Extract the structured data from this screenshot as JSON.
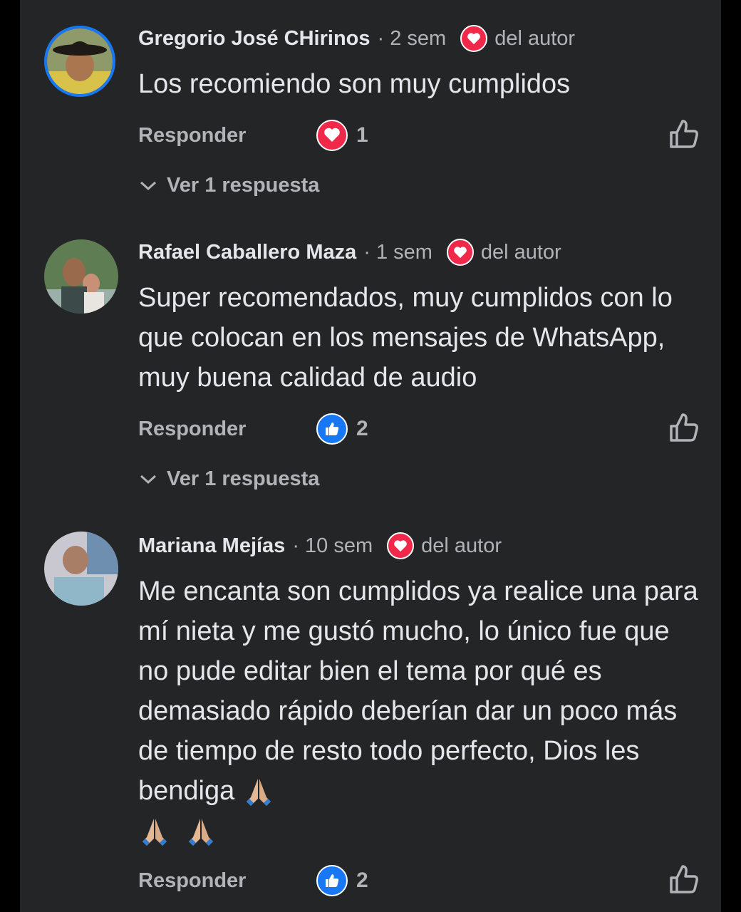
{
  "theme": {
    "background": "#242526",
    "text_primary": "#e4e6eb",
    "text_secondary": "#b0b3b8",
    "love_color": "#f0284a",
    "like_color": "#1877f2"
  },
  "comments": [
    {
      "author": "Gregorio José CHirinos",
      "time": "· 2 sem",
      "author_badge_icon": "heart-icon",
      "author_badge_label": "del autor",
      "text": "Los recomiendo son muy cumplidos",
      "reply_label": "Responder",
      "reaction_icon": "love-reaction-icon",
      "reaction_count": "1",
      "replies_label": "Ver 1 respuesta"
    },
    {
      "author": "Rafael Caballero Maza",
      "time": "· 1 sem",
      "author_badge_icon": "heart-icon",
      "author_badge_label": "del autor",
      "text": "Super recomendados, muy cumplidos con lo que colocan en los mensajes de WhatsApp, muy buena calidad de audio",
      "reply_label": "Responder",
      "reaction_icon": "like-reaction-icon",
      "reaction_count": "2",
      "replies_label": "Ver 1 respuesta"
    },
    {
      "author": "Mariana Mejías",
      "time": "· 10 sem",
      "author_badge_icon": "heart-icon",
      "author_badge_label": "del autor",
      "text": "Me encanta son cumplidos ya realice una para mí nieta y me gustó mucho, lo único fue que no pude editar bien el tema por qué es demasiado rápido deberían dar un poco más de tiempo de resto todo perfecto, Dios les bendiga",
      "emoji_icons": [
        "folded-hands-emoji",
        "folded-hands-emoji",
        "folded-hands-emoji"
      ],
      "reply_label": "Responder",
      "reaction_icon": "like-reaction-icon",
      "reaction_count": "2"
    }
  ]
}
